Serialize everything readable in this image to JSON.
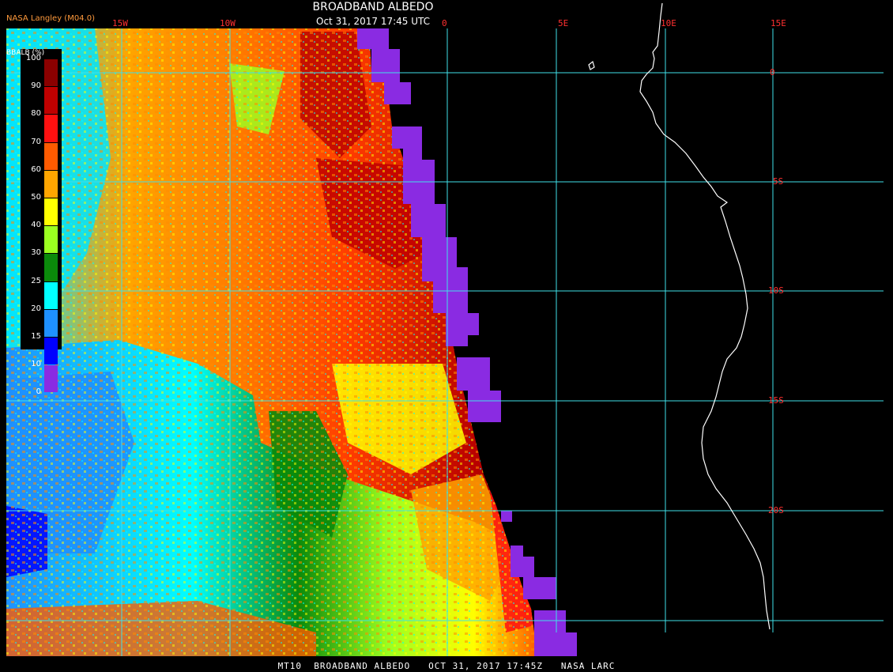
{
  "header": {
    "title": "BROADBAND ALBEDO",
    "subtitle": "Oct 31, 2017 17:45 UTC"
  },
  "legend": {
    "caption": "NASA Langley (M04.0)",
    "header": "BBALB (%)",
    "levels": [
      {
        "label": "100",
        "color": "#8b0000"
      },
      {
        "label": "90",
        "color": "#c00000"
      },
      {
        "label": "80",
        "color": "#ff1010"
      },
      {
        "label": "70",
        "color": "#ff5a00"
      },
      {
        "label": "60",
        "color": "#ffa500"
      },
      {
        "label": "50",
        "color": "#ffff00"
      },
      {
        "label": "40",
        "color": "#9cff20"
      },
      {
        "label": "30",
        "color": "#0b8a0b"
      },
      {
        "label": "25",
        "color": "#00ffff"
      },
      {
        "label": "20",
        "color": "#1e90ff"
      },
      {
        "label": "15",
        "color": "#0000ff"
      },
      {
        "label": "10",
        "color": "#8a2be2"
      },
      {
        "label": "0",
        "color": ""
      }
    ]
  },
  "grid": {
    "longitude_labels": [
      "15W",
      "10W",
      "0",
      "5E",
      "10E",
      "15E"
    ],
    "latitude_labels": [
      "0",
      "5S",
      "10S",
      "15S",
      "20S"
    ],
    "line_color": "#40e0e8",
    "label_color": "#ff3030"
  },
  "footer": {
    "text": "MT10  BROADBAND ALBEDO   OCT 31, 2017 17:45Z   NASA LARC"
  },
  "colors": {
    "background": "#000000",
    "no_data": "#8a2be2",
    "coastline": "#ffffff"
  }
}
